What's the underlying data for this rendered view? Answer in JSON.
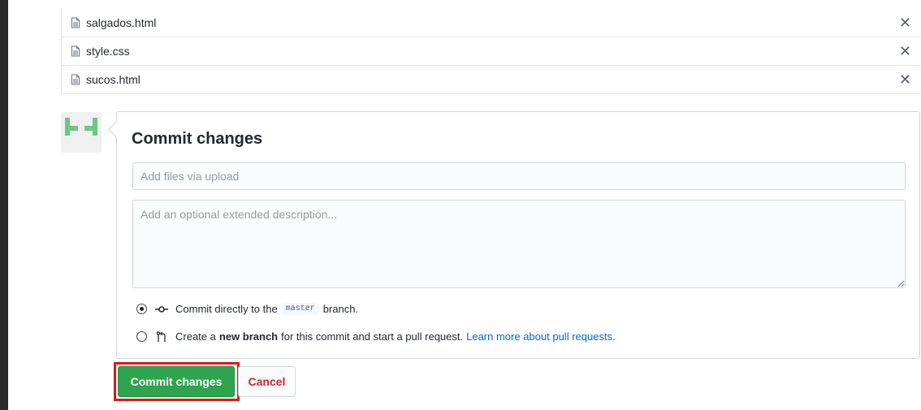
{
  "files": [
    {
      "name": "salgados.html",
      "remove_label": "✕"
    },
    {
      "name": "style.css",
      "remove_label": "✕"
    },
    {
      "name": "sucos.html",
      "remove_label": "✕"
    }
  ],
  "commit": {
    "title": "Commit changes",
    "summary_placeholder": "Add files via upload",
    "description_placeholder": "Add an optional extended description...",
    "option_direct": {
      "prefix": "Commit directly to the",
      "branch": "master",
      "suffix": "branch.",
      "selected": true
    },
    "option_new": {
      "prefix": "Create a",
      "bold": "new branch",
      "suffix": "for this commit and start a pull request.",
      "link": "Learn more about pull requests.",
      "selected": false
    },
    "commit_button": "Commit changes",
    "cancel_button": "Cancel"
  },
  "colors": {
    "primary_button": "#2ea44f",
    "cancel_text": "#cb2431",
    "highlight_outline": "#d21b1b",
    "link": "#0366d6",
    "background": "#2b2b2b"
  },
  "icons": {
    "file": "file-icon",
    "remove": "close-icon",
    "commit": "git-commit-icon",
    "pull_request": "git-pull-request-icon"
  }
}
